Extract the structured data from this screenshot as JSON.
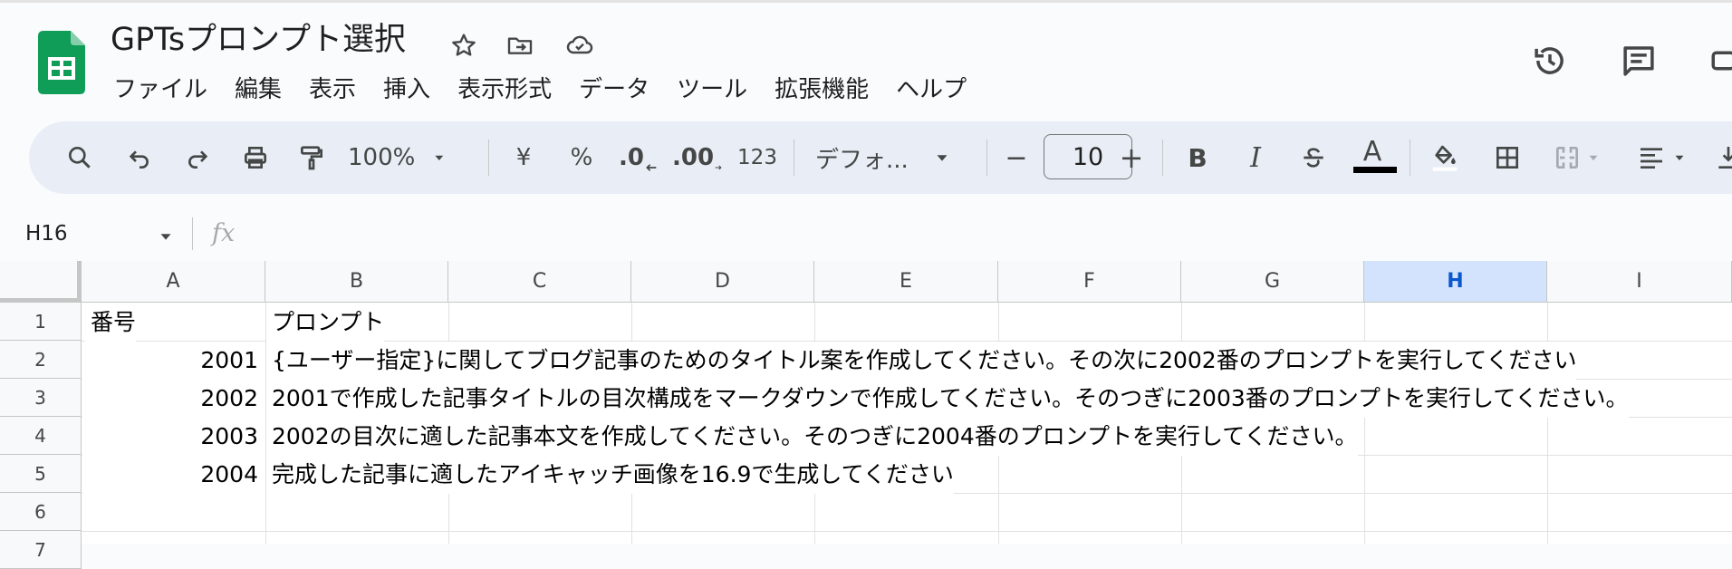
{
  "doc": {
    "title": "GPTsプロンプト選択"
  },
  "menu": [
    "ファイル",
    "編集",
    "表示",
    "挿入",
    "表示形式",
    "データ",
    "ツール",
    "拡張機能",
    "ヘルプ"
  ],
  "header_icons": [
    "star-icon",
    "move-to-folder-icon",
    "cloud-saved-icon",
    "version-history-icon",
    "comments-icon",
    "meet-icon"
  ],
  "toolbar": {
    "zoom": "100%",
    "currency": "¥",
    "percent": "%",
    "decrease_decimal": ".0",
    "increase_decimal": ".00",
    "more_formats": "123",
    "font": "デフォ...",
    "minus": "−",
    "font_size": "10",
    "plus": "+",
    "bold": "B",
    "italic": "I",
    "text_color_letter": "A",
    "text_color": "#000000"
  },
  "formula_bar": {
    "name_box": "H16",
    "fx": "fx",
    "value": ""
  },
  "sheet": {
    "columns": [
      "A",
      "B",
      "C",
      "D",
      "E",
      "F",
      "G",
      "H",
      "I"
    ],
    "selected_column": "H",
    "rows": [
      "1",
      "2",
      "3",
      "4",
      "5",
      "6",
      "7"
    ],
    "cells": {
      "A1": "番号",
      "B1": "プロンプト",
      "A2": "2001",
      "B2": "{ユーザー指定}に関してブログ記事のためのタイトル案を作成してください。その次に2002番のプロンプトを実行してください",
      "A3": "2002",
      "B3": "2001で作成した記事タイトルの目次構成をマークダウンで作成してください。そのつぎに2003番のプロンプトを実行してください。",
      "A4": "2003",
      "B4": "2002の目次に適した記事本文を作成してください。そのつぎに2004番のプロンプトを実行してください。",
      "A5": "2004",
      "B5": "完成した記事に適したアイキャッチ画像を16.9で生成してください"
    }
  },
  "colors": {
    "accent": "#0b57d0",
    "sheets_green": "#0f9d58",
    "selected_header": "#d3e3fd",
    "toolbar_bg": "#e9eef6"
  }
}
